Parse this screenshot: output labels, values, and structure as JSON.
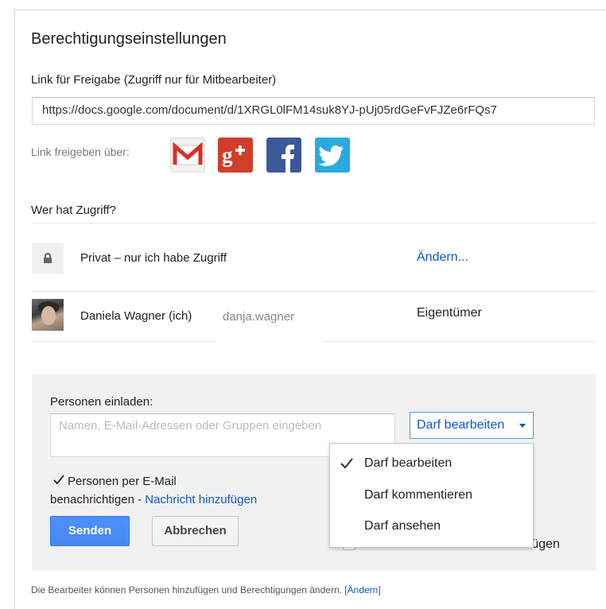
{
  "dialog": {
    "title": "Berechtigungseinstellungen"
  },
  "link_section": {
    "label": "Link für Freigabe (Zugriff nur für Mitbearbeiter)",
    "url": "https://docs.google.com/document/d/1XRGL0lFM14suk8YJ-pUj05rdGeFvFJZe6rFQs7",
    "share_label": "Link freigeben über:",
    "share_icons": [
      "gmail-icon",
      "google-plus-icon",
      "facebook-icon",
      "twitter-icon"
    ]
  },
  "access": {
    "label": "Wer hat Zugriff?",
    "privacy_text": "Privat – nur ich habe Zugriff",
    "change_label": "Ändern...",
    "owner_name": "Daniela Wagner (ich)",
    "owner_email": "danja.wagner",
    "owner_role": "Eigentümer"
  },
  "invite": {
    "label": "Personen einladen:",
    "placeholder": "Namen, E-Mail-Adressen oder Gruppen eingeben",
    "permission_selected": "Darf bearbeiten",
    "notify_label_line1": "Personen per E-Mail",
    "notify_label_line2": "benachrichtigen - ",
    "notify_link": "Nachricht hinzufügen",
    "notify_checked": true,
    "send_label": "Senden",
    "cancel_label": "Abbrechen",
    "obscured_text": "nfügen"
  },
  "permission_menu": {
    "items": [
      {
        "label": "Darf bearbeiten",
        "checked": true
      },
      {
        "label": "Darf kommentieren",
        "checked": false
      },
      {
        "label": "Darf ansehen",
        "checked": false
      }
    ]
  },
  "footer": {
    "text": "Die Bearbeiter können Personen hinzufügen und Berechtigungen ändern. ",
    "link": "Ändern"
  },
  "colors": {
    "link": "#1155cc",
    "primary_button": "#4d90fe",
    "panel_bg": "#f1f1f1"
  }
}
